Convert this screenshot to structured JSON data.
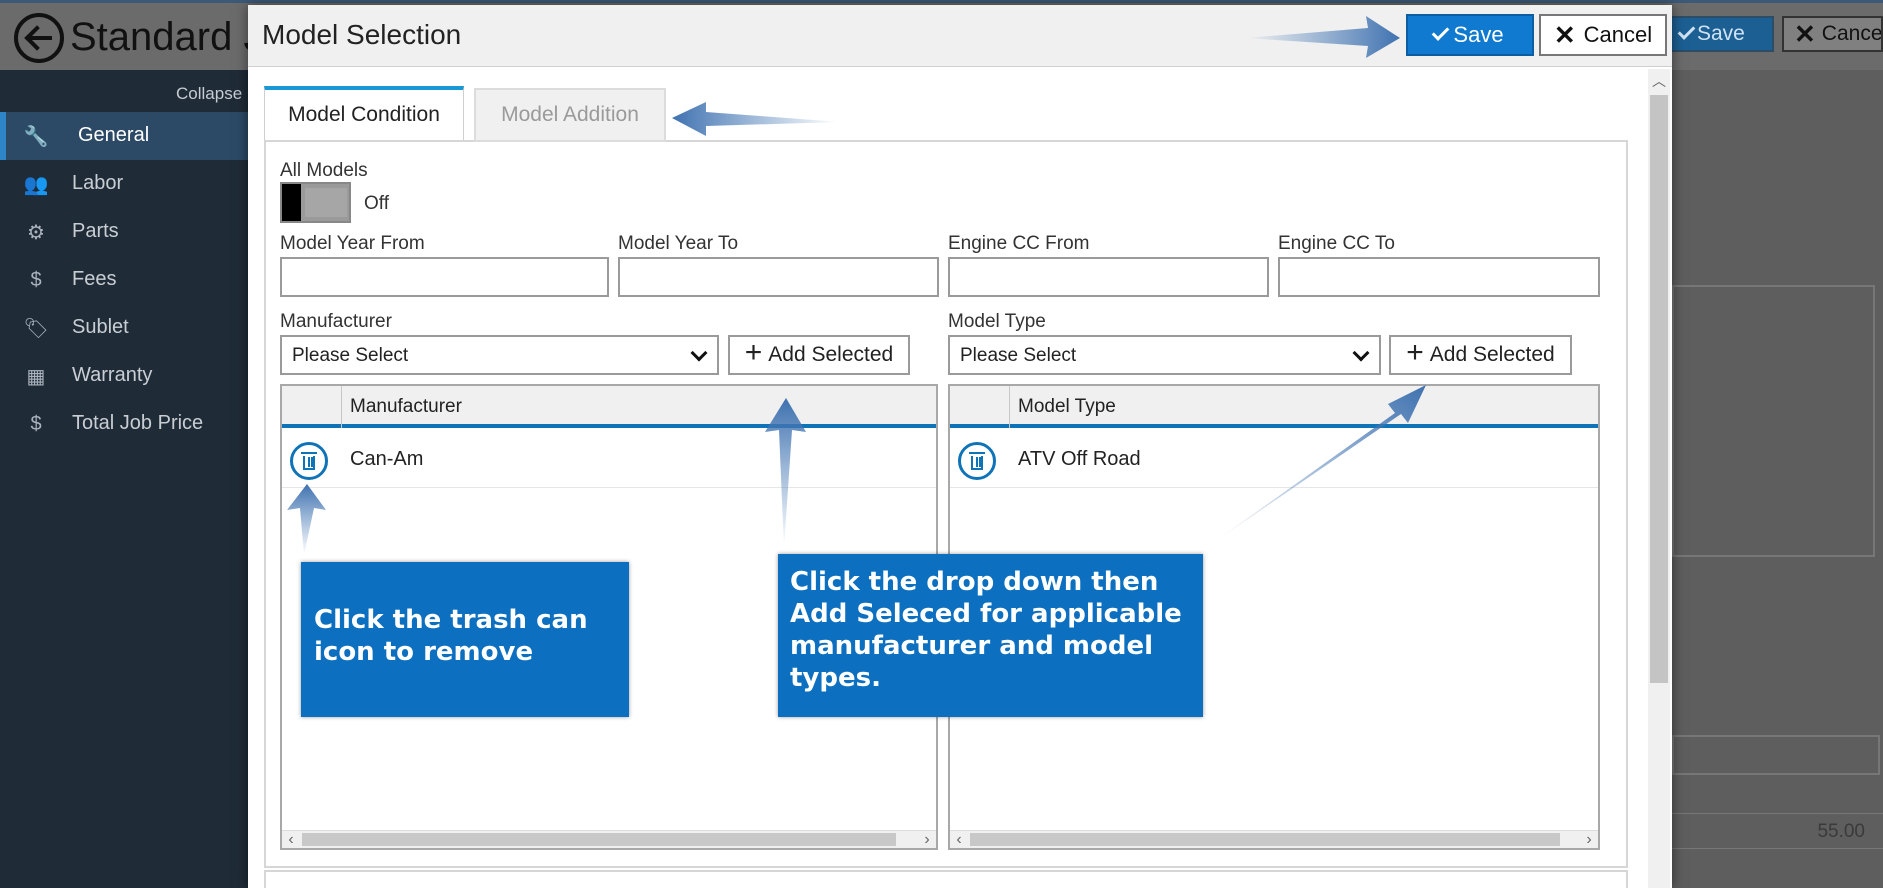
{
  "background": {
    "title": "Standard J",
    "collapse_label": "Collapse M",
    "save_label": "Save",
    "cancel_label": "Cancel",
    "price_value": "55.00",
    "sidebar": [
      {
        "label": "General",
        "icon": "wrench-icon"
      },
      {
        "label": "Labor",
        "icon": "people-icon"
      },
      {
        "label": "Parts",
        "icon": "gear-icon"
      },
      {
        "label": "Fees",
        "icon": "dollar-icon"
      },
      {
        "label": "Sublet",
        "icon": "tag-icon"
      },
      {
        "label": "Warranty",
        "icon": "calendar-icon"
      },
      {
        "label": "Total Job Price",
        "icon": "dollar-icon"
      }
    ]
  },
  "modal": {
    "title": "Model Selection",
    "save_label": "Save",
    "cancel_label": "Cancel",
    "tabs": [
      {
        "label": "Model Condition",
        "active": true
      },
      {
        "label": "Model Addition",
        "active": false
      }
    ],
    "all_models": {
      "label": "All Models",
      "state": "Off"
    },
    "fields": {
      "model_year_from": {
        "label": "Model Year From",
        "value": ""
      },
      "model_year_to": {
        "label": "Model Year To",
        "value": ""
      },
      "engine_cc_from": {
        "label": "Engine CC From",
        "value": ""
      },
      "engine_cc_to": {
        "label": "Engine CC To",
        "value": ""
      }
    },
    "manufacturer": {
      "label": "Manufacturer",
      "selected": "Please Select",
      "add_label": "Add Selected",
      "grid_header": "Manufacturer",
      "rows": [
        "Can-Am"
      ]
    },
    "model_type": {
      "label": "Model Type",
      "selected": "Please Select",
      "add_label": "Add Selected",
      "grid_header": "Model Type",
      "rows": [
        "ATV Off Road"
      ]
    }
  },
  "annotations": {
    "trash_callout": "Click the trash can icon to remove",
    "dropdown_callout": "Click the drop down then Add Seleced for applicable manufacturer and model types.",
    "accent_color": "#0c6fbf"
  }
}
